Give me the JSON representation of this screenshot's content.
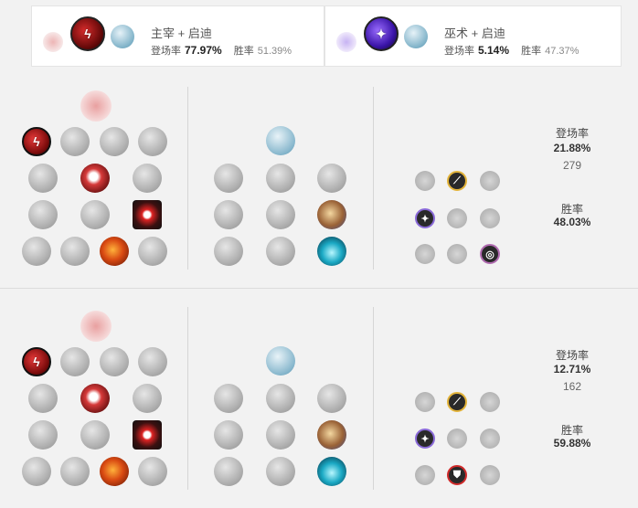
{
  "top": {
    "left": {
      "title": "主宰 + 启迪",
      "pick_label": "登场率",
      "pick_value": "77.97%",
      "win_label": "胜率",
      "win_value": "51.39%"
    },
    "right": {
      "title": "巫术 + 启迪",
      "pick_label": "登场率",
      "pick_value": "5.14%",
      "win_label": "胜率",
      "win_value": "47.37%"
    }
  },
  "builds": [
    {
      "pick_label": "登场率",
      "pick_value": "21.88%",
      "count": "279",
      "win_label": "胜率",
      "win_value": "48.03%"
    },
    {
      "pick_label": "登场率",
      "pick_value": "12.71%",
      "count": "162",
      "win_label": "胜率",
      "win_value": "59.88%"
    }
  ],
  "icons": {
    "primary_tree": "domination-icon",
    "secondary_tree": "inspiration-icon",
    "shards": [
      "adaptive-force-icon",
      "attack-speed-icon",
      "ability-haste-icon",
      "armor-icon",
      "magic-resist-icon",
      "health-icon"
    ]
  }
}
